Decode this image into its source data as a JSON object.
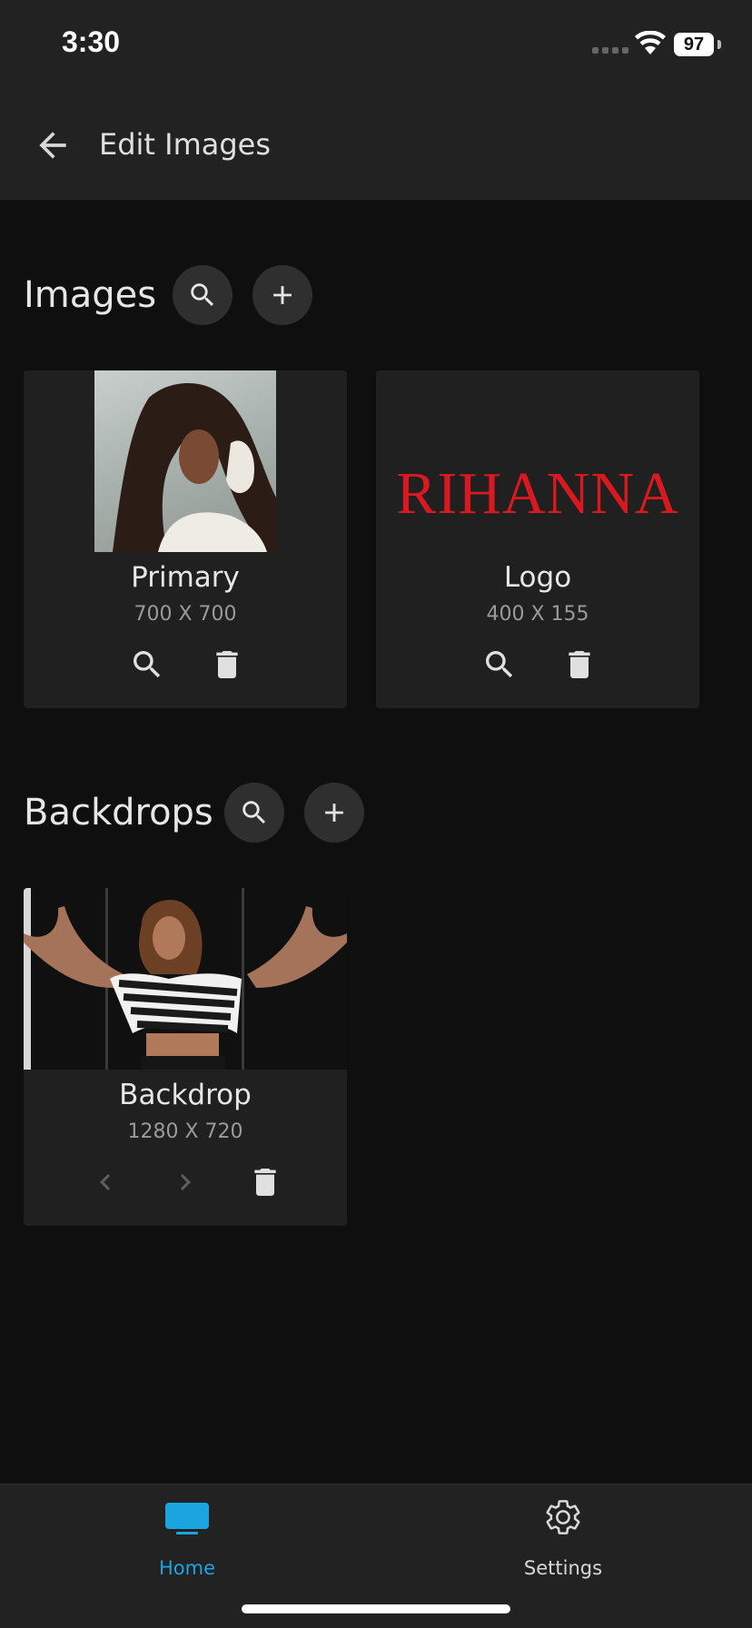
{
  "status": {
    "time": "3:30",
    "battery": "97"
  },
  "appbar": {
    "title": "Edit Images"
  },
  "images_section": {
    "title": "Images",
    "cards": [
      {
        "label": "Primary",
        "dimensions": "700 X 700"
      },
      {
        "label": "Logo",
        "dimensions": "400 X 155",
        "logo_text": "RIHANNA"
      }
    ]
  },
  "backdrops_section": {
    "title": "Backdrops",
    "cards": [
      {
        "label": "Backdrop",
        "dimensions": "1280 X 720"
      }
    ]
  },
  "nav": {
    "home_label": "Home",
    "settings_label": "Settings"
  },
  "colors": {
    "accent": "#1aa4e0",
    "logo_red": "#d8191f",
    "background": "#0f0f0f",
    "surface": "#202020"
  }
}
